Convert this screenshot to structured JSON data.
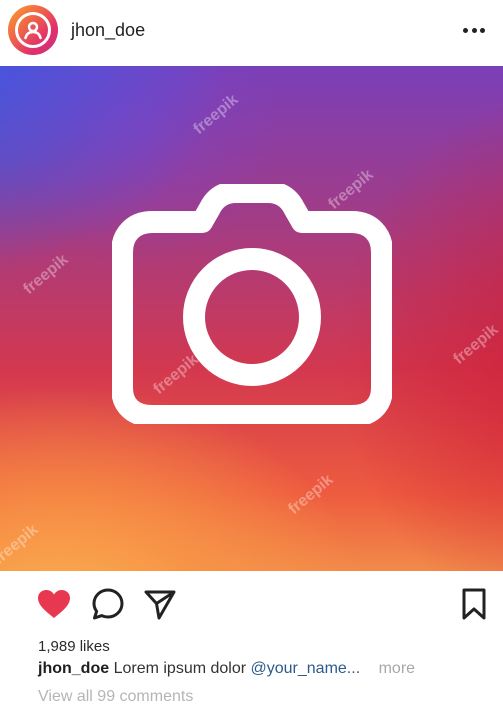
{
  "header": {
    "username": "jhon_doe",
    "avatar_icon": "user-icon",
    "more_icon": "more-horizontal-icon"
  },
  "photo": {
    "icon": "camera-icon",
    "watermark": "freepik"
  },
  "actions": {
    "like_icon": "heart-filled-icon",
    "comment_icon": "comment-icon",
    "share_icon": "send-icon",
    "save_icon": "bookmark-icon",
    "like_color": "#e8384f"
  },
  "likes_text": "1,989 likes",
  "caption": {
    "user": "jhon_doe",
    "text": "Lorem ipsum dolor",
    "mention": "@your_name...",
    "more": "more"
  },
  "comments_link": "View all 99 comments",
  "colors": {
    "gradient_blue": "#4058e2",
    "gradient_purple": "#a23c86",
    "gradient_red": "#d3384f",
    "gradient_orange": "#f9a12e"
  }
}
